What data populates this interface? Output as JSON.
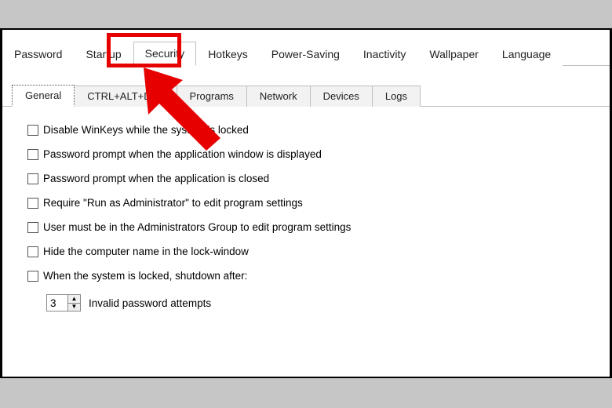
{
  "top_tabs": {
    "password": "Password",
    "startup": "Startup",
    "security": "Security",
    "hotkeys": "Hotkeys",
    "power_saving": "Power-Saving",
    "inactivity": "Inactivity",
    "wallpaper": "Wallpaper",
    "language": "Language"
  },
  "sub_tabs": {
    "general": "General",
    "ctrl_alt_del": "CTRL+ALT+DEL",
    "programs": "Programs",
    "network": "Network",
    "devices": "Devices",
    "logs": "Logs"
  },
  "options": {
    "disable_winkeys": "Disable WinKeys while the system is locked",
    "pw_prompt_displayed": "Password prompt when the application window is displayed",
    "pw_prompt_closed": "Password prompt when the application is closed",
    "require_admin": "Require \"Run as Administrator\" to edit program settings",
    "admins_group": "User must be in the Administrators Group to edit program settings",
    "hide_computer_name": "Hide the computer name in the lock-window",
    "shutdown_after": "When the system is locked, shutdown after:"
  },
  "spinner": {
    "value": "3",
    "label": "Invalid password attempts"
  }
}
